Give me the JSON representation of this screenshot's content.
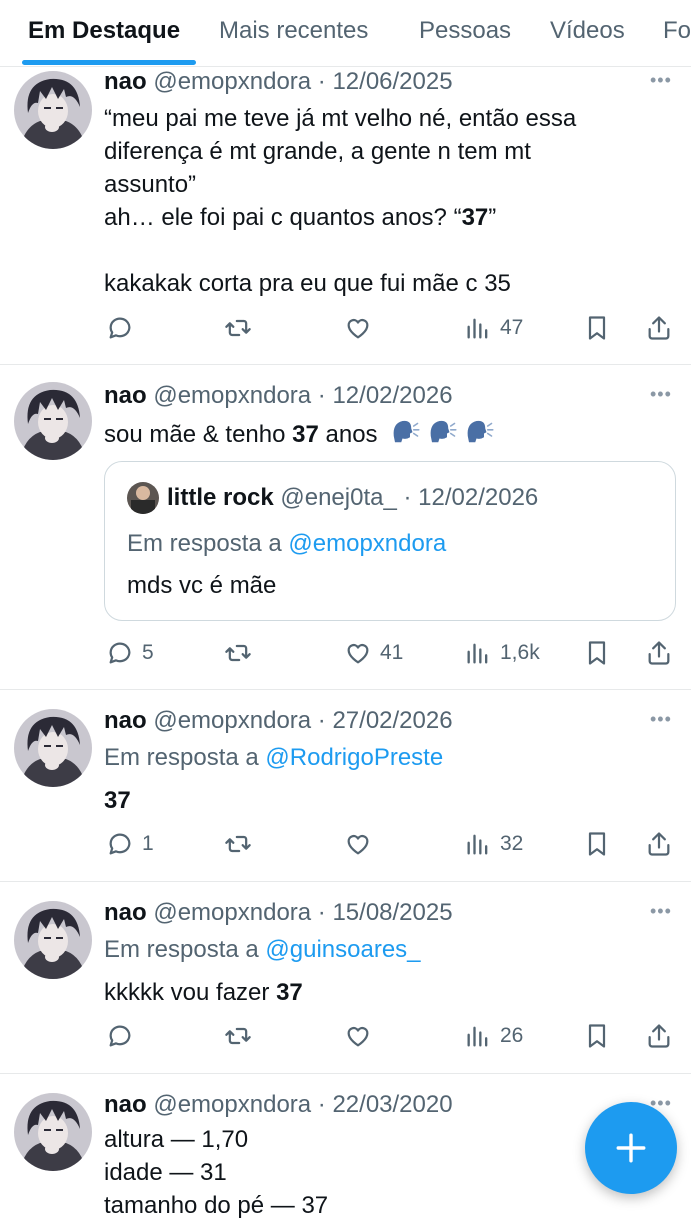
{
  "tabs": [
    "Em Destaque",
    "Mais recentes",
    "Pessoas",
    "Vídeos",
    "Fo"
  ],
  "icons": {
    "reply": "speech-bubble-icon",
    "retweet": "repost-arrows-icon",
    "like": "heart-icon",
    "views": "bar-chart-icon",
    "bookmark": "bookmark-icon",
    "share": "share-upload-icon",
    "more": "ellipsis-icon",
    "compose": "plus-icon"
  },
  "colors": {
    "accent": "#1d9bf0",
    "text": "#0f1419",
    "muted": "#536471",
    "border": "#e7e9ea"
  },
  "emoji_sequence": "🗣️🗣️🗣️",
  "tweets": [
    {
      "name": "nao",
      "handle": "@emopxndora",
      "date": "· 12/06/2025",
      "lines": [
        "“meu pai me teve já mt velho né, então essa",
        "diferença é mt grande, a gente n tem mt",
        "assunto”"
      ],
      "line4_pre": "ah… ele foi pai c quantos anos? “",
      "line4_bold": "37",
      "line4_post": "”",
      "line5": "kakakak corta pra eu que fui mãe c 35",
      "replies": "",
      "likes": "",
      "views": "47"
    },
    {
      "name": "nao",
      "handle": "@emopxndora",
      "date": "· 12/02/2026",
      "text_pre": "sou mãe & tenho ",
      "text_bold": "37",
      "text_post": " anos",
      "quote": {
        "name": "little rock",
        "handle": "@enej0ta_",
        "date": "· 12/02/2026",
        "reply_prefix": "Em resposta a ",
        "reply_to": "@emopxndora",
        "text": "mds vc é mãe"
      },
      "replies": "5",
      "likes": "41",
      "views": "1,6k"
    },
    {
      "name": "nao",
      "handle": "@emopxndora",
      "date": "· 27/02/2026",
      "reply_prefix": "Em resposta a ",
      "reply_to": "@RodrigoPreste",
      "text_bold": "37",
      "replies": "1",
      "likes": "",
      "views": "32"
    },
    {
      "name": "nao",
      "handle": "@emopxndora",
      "date": "· 15/08/2025",
      "reply_prefix": "Em resposta a ",
      "reply_to": "@guinsoares_",
      "text_pre": "kkkkk vou fazer ",
      "text_bold": "37",
      "replies": "",
      "likes": "",
      "views": "26"
    },
    {
      "name": "nao",
      "handle": "@emopxndora",
      "date": "· 22/03/2020",
      "lines": [
        "altura — 1,70",
        "idade — 31",
        "tamanho do pé — 37"
      ]
    }
  ]
}
